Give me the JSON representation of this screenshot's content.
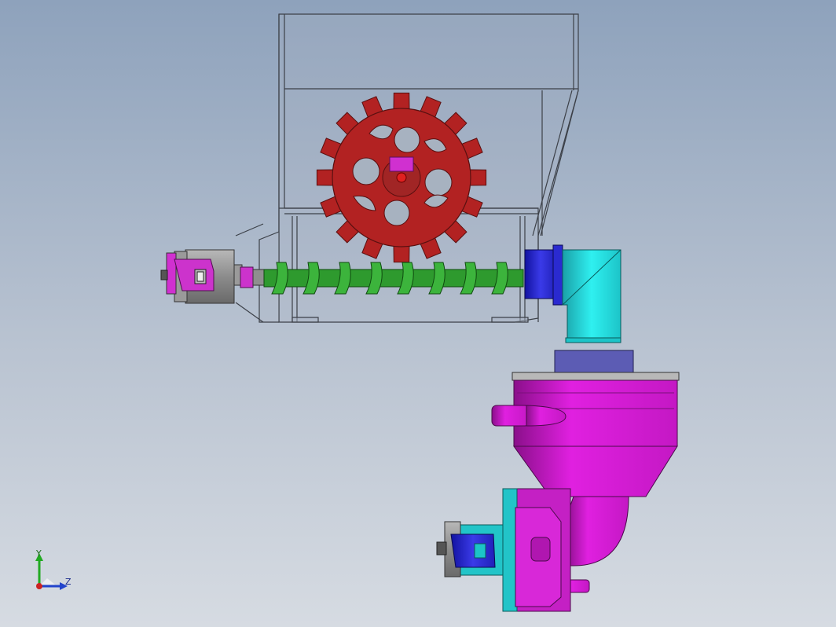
{
  "viewport": {
    "background_top": "#8ea2bc",
    "background_bottom": "#d6dbe2"
  },
  "parts": {
    "hopper": {
      "color": "#9aa6b6"
    },
    "gear": {
      "color": "#b22222",
      "teeth": 16
    },
    "auger_screw": {
      "color": "#2e9a2e"
    },
    "screw_motor": {
      "color": "#8f8f8f"
    },
    "coupling": {
      "color": "#cc33cc"
    },
    "flange": {
      "color": "#2a2ad0"
    },
    "elbow_pipe": {
      "color": "#22d3d3"
    },
    "mixing_chamber": {
      "color": "#d21ad2"
    },
    "lower_pump": {
      "color": "#cc33cc"
    }
  },
  "triad": {
    "y_label": "Y",
    "z_label": "Z",
    "y_color": "#22aa22",
    "z_color": "#2244cc",
    "x_color": "#cc2222"
  }
}
